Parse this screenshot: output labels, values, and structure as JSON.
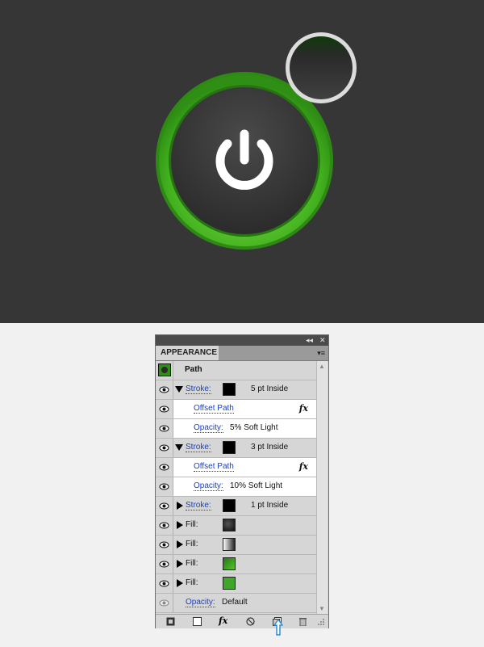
{
  "panel": {
    "tab_label": "APPEARANCE",
    "collapse_glyph": "◂◂",
    "close_glyph": "✕",
    "menu_glyph": "▾≡",
    "object_label": "Path",
    "rows": [
      {
        "kind": "stroke",
        "expanded": true,
        "label": "Stroke:",
        "color": "#000000",
        "value": "5 pt  Inside"
      },
      {
        "kind": "effect",
        "label": "Offset Path",
        "fx": "fx"
      },
      {
        "kind": "opacity",
        "label": "Opacity:",
        "value": "5% Soft Light"
      },
      {
        "kind": "stroke",
        "expanded": true,
        "label": "Stroke:",
        "color": "#000000",
        "value": "3 pt  Inside"
      },
      {
        "kind": "effect",
        "label": "Offset Path",
        "fx": "fx"
      },
      {
        "kind": "opacity",
        "label": "Opacity:",
        "value": "10% Soft Light"
      },
      {
        "kind": "stroke",
        "expanded": false,
        "label": "Stroke:",
        "color": "#000000",
        "value": "1 pt  Inside"
      },
      {
        "kind": "fill",
        "label": "Fill:",
        "swatch": "radial-dark"
      },
      {
        "kind": "fill",
        "label": "Fill:",
        "swatch": "linear-grey"
      },
      {
        "kind": "fill",
        "label": "Fill:",
        "swatch": "linear-green"
      },
      {
        "kind": "fill",
        "label": "Fill:",
        "swatch": "solid-green"
      },
      {
        "kind": "global-opacity",
        "label": "Opacity:",
        "value": "Default"
      }
    ],
    "fx_glyph": "fx"
  },
  "artwork": {
    "ring_color": "#3fae1c",
    "ring_highlight": "#8ee04e",
    "button_face": "#3a3a3a",
    "icon_color": "#ffffff",
    "icon": "power-icon"
  },
  "colors": {
    "link": "#1a3fbf",
    "canvas": "#363636"
  }
}
